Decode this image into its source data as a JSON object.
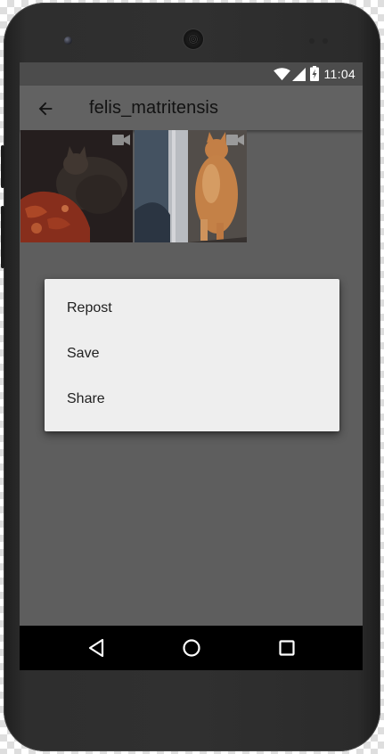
{
  "status_bar": {
    "time": "11:04",
    "icons": [
      "wifi-icon",
      "signal-icon",
      "battery-charging-icon"
    ]
  },
  "app_bar": {
    "title": "felis_matritensis",
    "back_icon": "arrow-back-icon"
  },
  "gallery": {
    "items": [
      {
        "type": "video",
        "icon": "videocam-icon"
      },
      {
        "type": "video",
        "icon": "videocam-icon"
      }
    ]
  },
  "context_menu": {
    "items": [
      "Repost",
      "Save",
      "Share"
    ]
  },
  "nav_bar": {
    "buttons": [
      "back-triangle-icon",
      "home-circle-icon",
      "recents-square-icon"
    ]
  },
  "colors": {
    "screen_background": "#5e5e5e",
    "status_bar": "#4c4c4c",
    "app_bar": "#626262",
    "dialog": "#eeeeee",
    "navigation_bar": "#000000"
  }
}
